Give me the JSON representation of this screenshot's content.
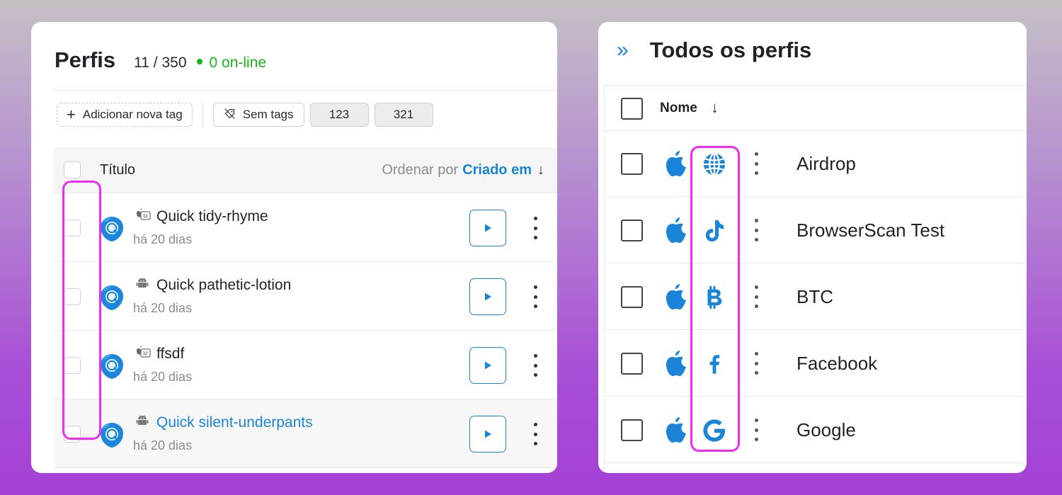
{
  "colors": {
    "accent": "#1a84d8",
    "online": "#1cb21c",
    "highlight": "#f02cf2"
  },
  "left": {
    "title": "Perfis",
    "count": "11 / 350",
    "online": "0 on-line",
    "tags": {
      "add_label": "Adicionar nova tag",
      "no_tags_label": "Sem tags",
      "tag1": "123",
      "tag2": "321"
    },
    "table": {
      "title_col": "Título",
      "sort_prefix": "Ordenar por",
      "sort_value": "Criado em"
    },
    "rows": [
      {
        "os_icon": "macos-m-icon",
        "name": "Quick tidy-rhyme",
        "date": "há 20 dias",
        "browser_icon": "browser-logo-icon"
      },
      {
        "os_icon": "android-icon",
        "name": "Quick pathetic-lotion",
        "date": "há 20 dias",
        "browser_icon": "browser-logo-icon"
      },
      {
        "os_icon": "macos-m-icon",
        "name": "ffsdf",
        "date": "há 20 dias",
        "browser_icon": "browser-logo-icon"
      },
      {
        "os_icon": "android-icon",
        "name": "Quick silent-underpants",
        "date": "há 20 dias",
        "browser_icon": "browser-logo-icon"
      }
    ]
  },
  "right": {
    "title": "Todos os perfis",
    "column_name": "Nome",
    "rows": [
      {
        "os_icon": "apple-icon",
        "site_icon": "globe-icon",
        "name": "Airdrop"
      },
      {
        "os_icon": "apple-icon",
        "site_icon": "tiktok-icon",
        "name": "BrowserScan Test"
      },
      {
        "os_icon": "apple-icon",
        "site_icon": "bitcoin-icon",
        "name": "BTC"
      },
      {
        "os_icon": "apple-icon",
        "site_icon": "facebook-icon",
        "name": "Facebook"
      },
      {
        "os_icon": "apple-icon",
        "site_icon": "google-icon",
        "name": "Google"
      }
    ]
  }
}
